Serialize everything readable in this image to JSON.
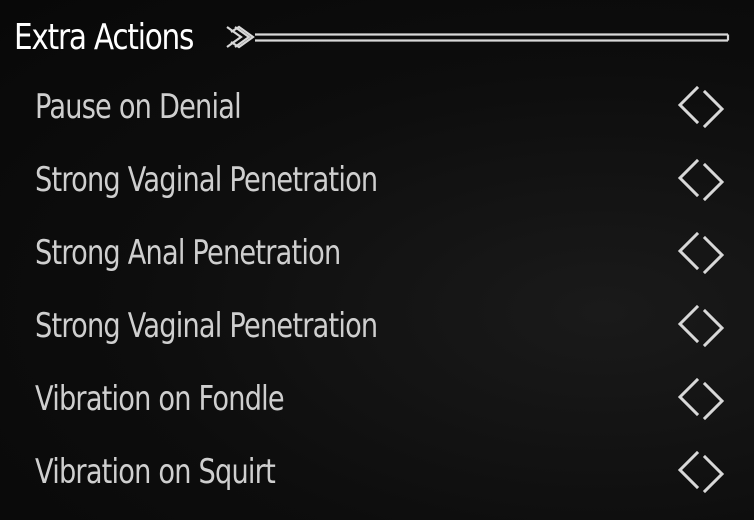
{
  "header": {
    "title": "Extra Actions",
    "ornament_icon": "knot-line-ornament-icon"
  },
  "options": [
    {
      "label": "Pause on Denial",
      "toggle_icon": "empty-diamond-icon",
      "checked": false
    },
    {
      "label": "Strong Vaginal Penetration",
      "toggle_icon": "empty-diamond-icon",
      "checked": false
    },
    {
      "label": "Strong Anal Penetration",
      "toggle_icon": "empty-diamond-icon",
      "checked": false
    },
    {
      "label": "Strong Vaginal Penetration",
      "toggle_icon": "empty-diamond-icon",
      "checked": false
    },
    {
      "label": "Vibration on Fondle",
      "toggle_icon": "empty-diamond-icon",
      "checked": false
    },
    {
      "label": "Vibration on Squirt",
      "toggle_icon": "empty-diamond-icon",
      "checked": false
    }
  ],
  "colors": {
    "background": "#0b0b0b",
    "title": "#ffffff",
    "label": "#cfcfcf",
    "icon": "#d8d8d8"
  }
}
